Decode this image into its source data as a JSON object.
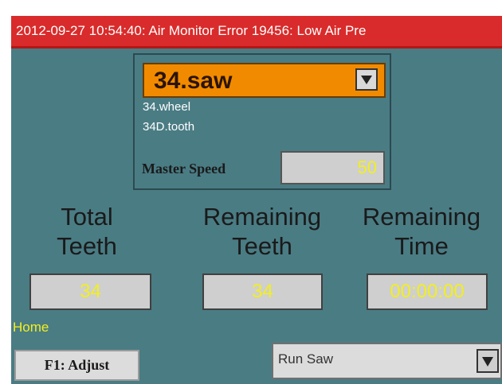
{
  "alarm": {
    "text": "2012-09-27 10:54:40: Air Monitor Error 19456: Low Air Pre"
  },
  "job": {
    "selected": "34.saw",
    "options": [
      "34.wheel",
      "34D.tooth"
    ],
    "dropdown_icon": "triangle-down-icon"
  },
  "master_speed": {
    "label": "Master Speed",
    "value": "50"
  },
  "stats": {
    "total_teeth": {
      "label_line1": "Total",
      "label_line2": "Teeth",
      "value": "34"
    },
    "remaining_teeth": {
      "label_line1": "Remaining",
      "label_line2": "Teeth",
      "value": "34"
    },
    "remaining_time": {
      "label_line1": "Remaining",
      "label_line2": "Time",
      "value": "00:00:00"
    }
  },
  "footer": {
    "home_label": "Home",
    "f1_button": "F1: Adjust",
    "run_select": "Run Saw",
    "run_dropdown_icon": "triangle-down-icon"
  },
  "colors": {
    "background": "#4a7c84",
    "alarm": "#d92b2b",
    "job_select": "#f28a00",
    "value_text": "#f2ef1e"
  }
}
